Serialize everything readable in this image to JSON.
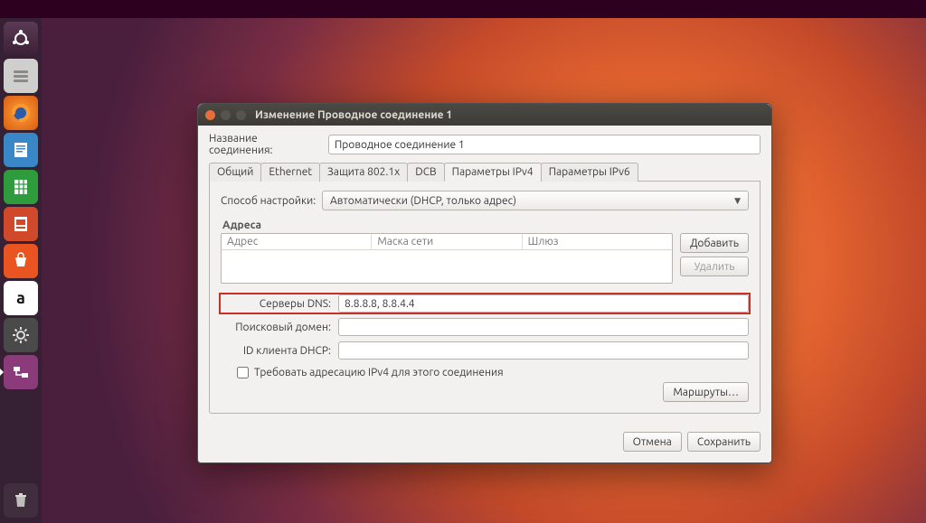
{
  "window": {
    "title": "Изменение Проводное соединение 1"
  },
  "connection": {
    "name_label": "Название соединения:",
    "name_value": "Проводное соединение 1"
  },
  "tabs": {
    "general": "Общий",
    "ethernet": "Ethernet",
    "security": "Защита 802.1x",
    "dcb": "DCB",
    "ipv4": "Параметры IPv4",
    "ipv6": "Параметры IPv6"
  },
  "ipv4": {
    "method_label": "Способ настройки:",
    "method_value": "Автоматически (DHCP, только адрес)",
    "addresses_label": "Адреса",
    "col_address": "Адрес",
    "col_netmask": "Маска сети",
    "col_gateway": "Шлюз",
    "btn_add": "Добавить",
    "btn_delete": "Удалить",
    "dns_label": "Серверы DNS:",
    "dns_value": "8.8.8.8, 8.8.4.4",
    "search_label": "Поисковый домен:",
    "search_value": "",
    "dhcp_id_label": "ID клиента DHCP:",
    "dhcp_id_value": "",
    "require_ipv4": "Требовать адресацию IPv4 для этого соединения",
    "routes_btn": "Маршруты…"
  },
  "footer": {
    "cancel": "Отмена",
    "save": "Сохранить"
  },
  "launcher": {
    "items": [
      {
        "name": "ubuntu-dash"
      },
      {
        "name": "files"
      },
      {
        "name": "firefox"
      },
      {
        "name": "libreoffice-writer"
      },
      {
        "name": "libreoffice-calc"
      },
      {
        "name": "libreoffice-impress"
      },
      {
        "name": "ubuntu-software"
      },
      {
        "name": "amazon"
      },
      {
        "name": "system-settings"
      },
      {
        "name": "network-connections"
      }
    ],
    "trash": "trash"
  }
}
